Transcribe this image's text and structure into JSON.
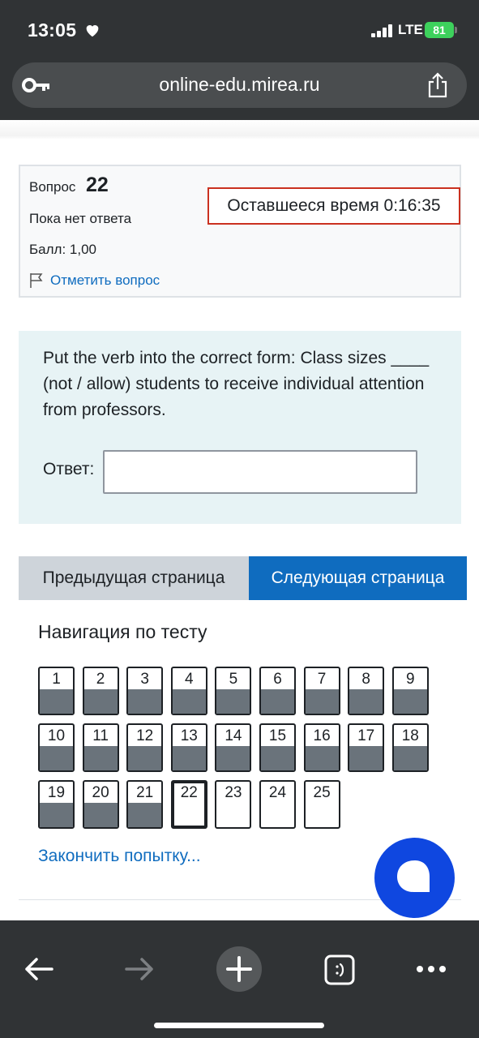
{
  "status_bar": {
    "time": "13:05",
    "network": "LTE",
    "battery": "81"
  },
  "browser": {
    "url": "online-edu.mirea.ru"
  },
  "question_info": {
    "label": "Вопрос",
    "number": "22",
    "status": "Пока нет ответа",
    "score": "Балл: 1,00",
    "flag_label": "Отметить вопрос"
  },
  "timer": {
    "text": "Оставшееся время 0:16:35"
  },
  "question": {
    "text": "Put the verb into the correct form: Class sizes ____ (not / allow) students to receive individual attention from professors.",
    "answer_label": "Ответ:",
    "answer_value": ""
  },
  "buttons": {
    "prev": "Предыдущая страница",
    "next": "Следующая страница"
  },
  "navigation": {
    "title": "Навигация по тесту",
    "items": [
      {
        "label": "1",
        "answered": true
      },
      {
        "label": "2",
        "answered": true
      },
      {
        "label": "3",
        "answered": true
      },
      {
        "label": "4",
        "answered": true
      },
      {
        "label": "5",
        "answered": true
      },
      {
        "label": "6",
        "answered": true
      },
      {
        "label": "7",
        "answered": true
      },
      {
        "label": "8",
        "answered": true
      },
      {
        "label": "9",
        "answered": true
      },
      {
        "label": "10",
        "answered": true
      },
      {
        "label": "11",
        "answered": true
      },
      {
        "label": "12",
        "answered": true
      },
      {
        "label": "13",
        "answered": true
      },
      {
        "label": "14",
        "answered": true
      },
      {
        "label": "15",
        "answered": true
      },
      {
        "label": "16",
        "answered": true
      },
      {
        "label": "17",
        "answered": true
      },
      {
        "label": "18",
        "answered": true
      },
      {
        "label": "19",
        "answered": true
      },
      {
        "label": "20",
        "answered": true
      },
      {
        "label": "21",
        "answered": true
      },
      {
        "label": "22",
        "answered": false,
        "current": true
      },
      {
        "label": "23",
        "answered": false
      },
      {
        "label": "24",
        "answered": false
      },
      {
        "label": "25",
        "answered": false
      }
    ],
    "finish_link": "Закончить попытку..."
  },
  "icons": {
    "heart": "heart-icon",
    "key": "key-icon",
    "share": "share-icon",
    "flag": "flag-icon",
    "chat": "chat-icon",
    "back": "arrow-left-icon",
    "forward": "arrow-right-icon",
    "new_tab": "plus-icon",
    "tabs": "tabs-icon",
    "more": "more-icon"
  },
  "colors": {
    "accent": "#0f6cbf",
    "timer_border": "#ca3120",
    "answered_fill": "#6a737b",
    "chat_fab": "#0f47e0"
  }
}
